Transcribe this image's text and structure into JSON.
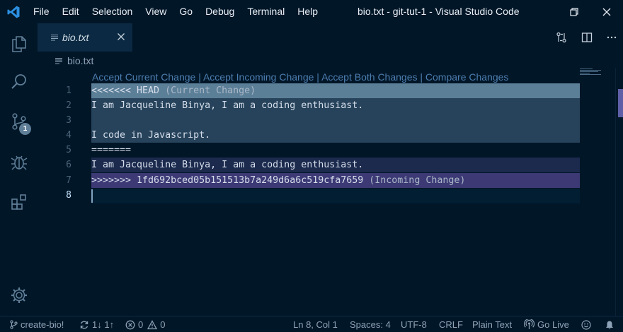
{
  "menu": {
    "items": [
      "File",
      "Edit",
      "Selection",
      "View",
      "Go",
      "Debug",
      "Terminal",
      "Help"
    ]
  },
  "window": {
    "title": "bio.txt - git-tut-1 - Visual Studio Code"
  },
  "activity": {
    "source_control_badge": "1"
  },
  "tab": {
    "label": "bio.txt"
  },
  "breadcrumb": {
    "file": "bio.txt"
  },
  "codelens": {
    "accept_current": "Accept Current Change",
    "accept_incoming": "Accept Incoming Change",
    "accept_both": "Accept Both Changes",
    "compare": "Compare Changes",
    "separator": " | "
  },
  "editor": {
    "line_numbers": [
      "1",
      "2",
      "3",
      "4",
      "5",
      "6",
      "7",
      "8"
    ],
    "line1_text": "<<<<<<< HEAD",
    "line1_label": " (Current Change)",
    "line2_text": "I am Jacqueline Binya, I am a coding enthusiast.",
    "line3_text": "",
    "line4_text": "I code in Javascript.",
    "line5_text": "=======",
    "line6_text": "I am Jacqueline Binya, I am a coding enthusiast.",
    "line7_text": ">>>>>>> 1fd692bced05b151513b7a249d6a6c519cfa7659",
    "line7_label": " (Incoming Change)",
    "line8_text": ""
  },
  "statusbar": {
    "branch": "create-bio!",
    "sync": "1↓ 1↑",
    "errors": "0",
    "warnings": "0",
    "position": "Ln 8, Col 1",
    "spaces": "Spaces: 4",
    "encoding": "UTF-8",
    "eol": "CRLF",
    "language": "Plain Text",
    "live": "Go Live"
  },
  "colors": {
    "background": "#011627",
    "current_change": "#26435b",
    "incoming_change": "#1c2a4d",
    "incoming_header": "#3c3975",
    "codelens_link": "#4d7eb0"
  },
  "icons": [
    "vscode-logo-icon",
    "files-icon",
    "search-icon",
    "source-control-icon",
    "debug-icon",
    "extensions-icon",
    "gear-icon",
    "close-icon",
    "split-editor-icon",
    "open-changes-icon",
    "more-actions-icon",
    "branch-icon",
    "sync-icon",
    "error-icon",
    "warning-icon",
    "broadcast-icon",
    "feedback-icon",
    "bell-icon"
  ]
}
